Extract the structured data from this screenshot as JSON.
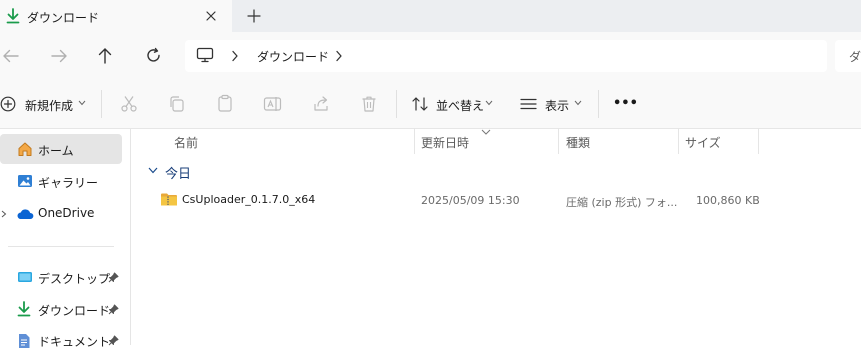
{
  "window": {
    "tab_title": "ダウンロード",
    "new_tab_symbol": "+"
  },
  "nav": {
    "breadcrumb": "ダウンロード",
    "search_placeholder": "ダ"
  },
  "command_bar": {
    "new_label": "新規作成",
    "sort_label": "並べ替え",
    "view_label": "表示",
    "more_label": "•••"
  },
  "sidebar": {
    "items": [
      {
        "label": "ホーム",
        "icon": "home-icon",
        "selected": true
      },
      {
        "label": "ギャラリー",
        "icon": "gallery-icon"
      },
      {
        "label": "OneDrive",
        "icon": "onedrive-icon"
      }
    ],
    "pinned": [
      {
        "label": "デスクトップ",
        "icon": "desktop-folder-icon"
      },
      {
        "label": "ダウンロード",
        "icon": "download-icon"
      },
      {
        "label": "ドキュメント",
        "icon": "documents-icon"
      }
    ]
  },
  "columns": {
    "name": "名前",
    "date": "更新日時",
    "type": "種類",
    "size": "サイズ"
  },
  "groups": [
    {
      "label": "今日",
      "files": [
        {
          "name": "CsUploader_0.1.7.0_x64",
          "date": "2025/05/09 15:30",
          "type": "圧縮 (zip 形式) フォ...",
          "size": "100,860 KB",
          "icon": "zip-folder-icon"
        }
      ]
    }
  ],
  "colors": {
    "accent": "#1a9b4b",
    "selection": "#e5e5e5",
    "toolbar_bg": "#f9f9f9",
    "tabbar_bg": "#eceef1",
    "folder_yellow": "#f4c542"
  }
}
